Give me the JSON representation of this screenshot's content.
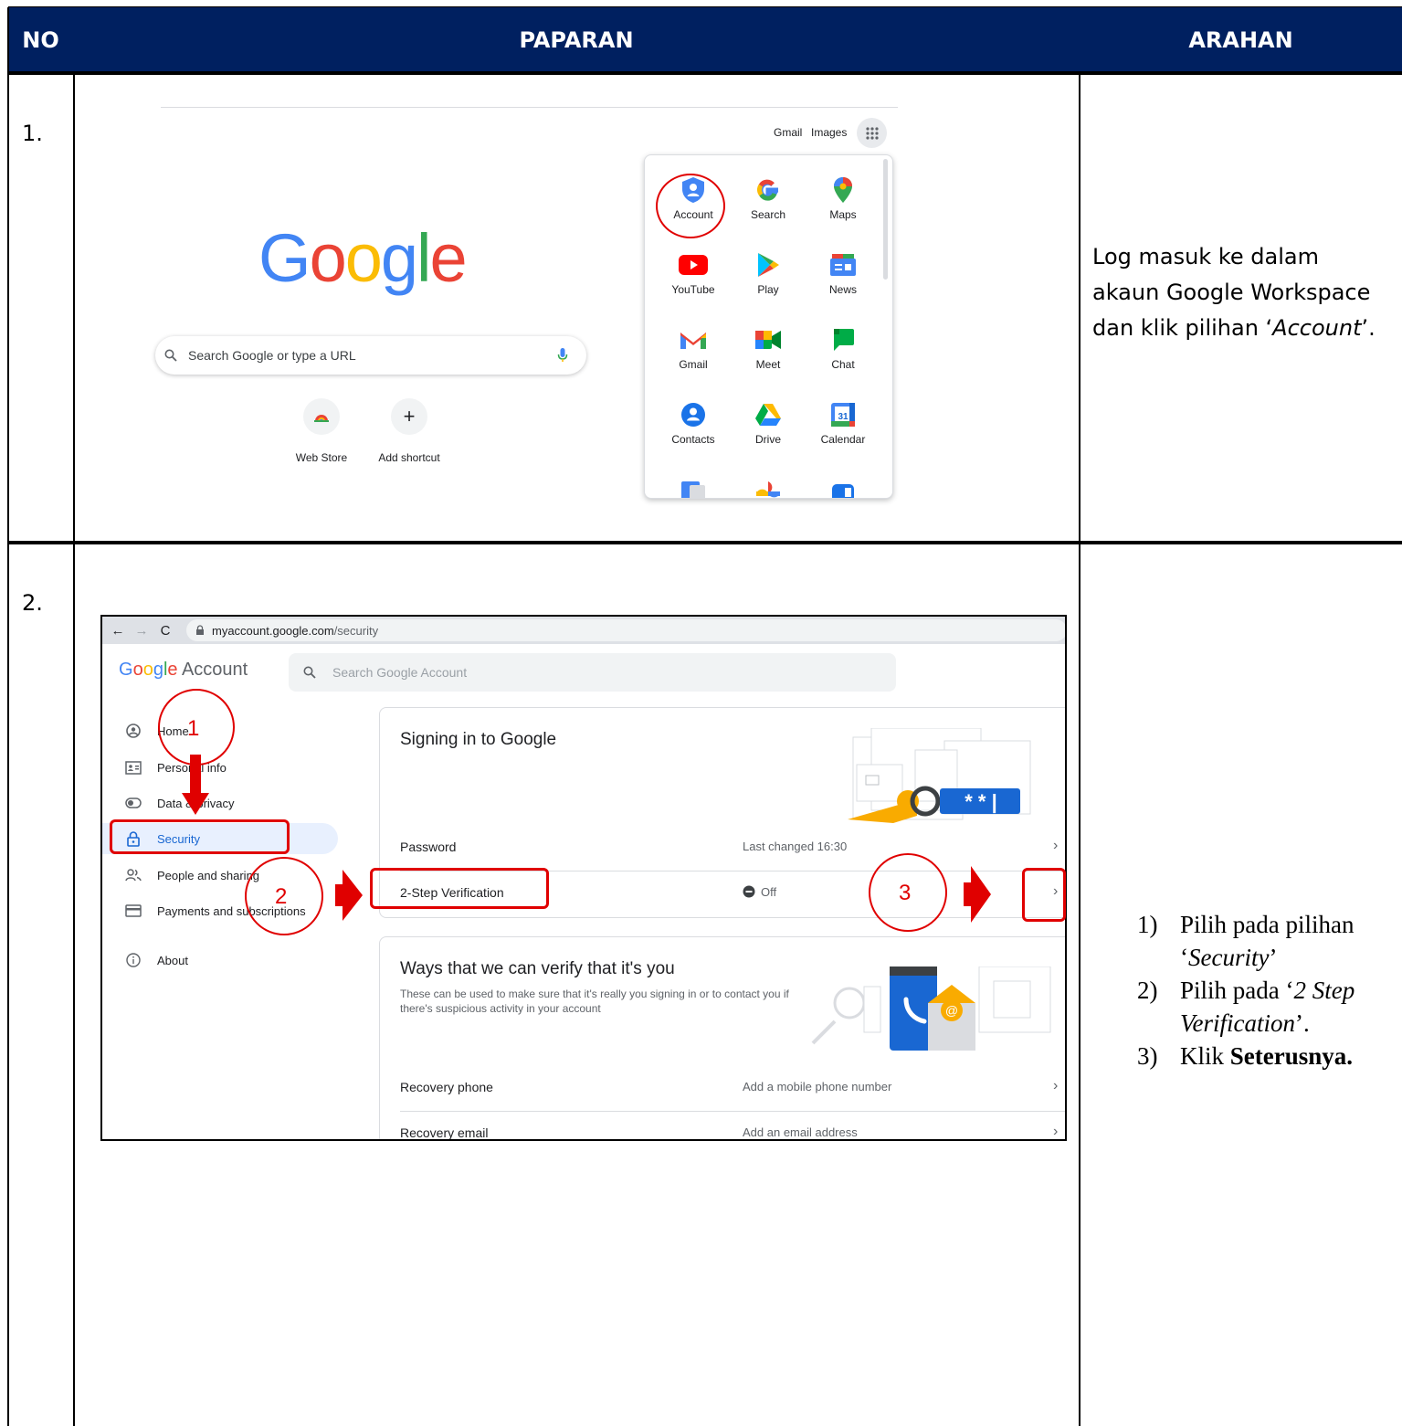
{
  "table": {
    "headers": [
      "NO",
      "PAPARAN",
      "ARAHAN"
    ],
    "rows": [
      {
        "no": "1.",
        "instruction_parts": [
          "Log masuk ke dalam akaun Google Workspace dan klik pilihan ‘",
          "Account",
          "’."
        ]
      },
      {
        "no": "2.",
        "steps": [
          {
            "num": "1)",
            "parts": [
              "Pilih pada pilihan ‘",
              "Security",
              "’"
            ]
          },
          {
            "num": "2)",
            "parts": [
              " Pilih pada ‘",
              "2 Step Verification",
              "’."
            ]
          },
          {
            "num": "3)",
            "parts": [
              "Klik ",
              "Seterusnya."
            ]
          }
        ]
      }
    ]
  },
  "screen1": {
    "top_links": [
      "Gmail",
      "Images"
    ],
    "logo_letters": [
      {
        "ch": "G",
        "color": "#4285F4"
      },
      {
        "ch": "o",
        "color": "#EA4335"
      },
      {
        "ch": "o",
        "color": "#FBBC05"
      },
      {
        "ch": "g",
        "color": "#4285F4"
      },
      {
        "ch": "l",
        "color": "#34A853"
      },
      {
        "ch": "e",
        "color": "#EA4335"
      }
    ],
    "search_placeholder": "Search Google or type a URL",
    "shortcuts": [
      {
        "label": "Web Store",
        "icon": "chrome-web-store-icon"
      },
      {
        "label": "Add shortcut",
        "icon": "plus-icon"
      }
    ],
    "apps": [
      {
        "label": "Account",
        "icon": "account-shield-icon"
      },
      {
        "label": "Search",
        "icon": "google-g-icon"
      },
      {
        "label": "Maps",
        "icon": "maps-pin-icon"
      },
      {
        "label": "YouTube",
        "icon": "youtube-icon"
      },
      {
        "label": "Play",
        "icon": "play-icon"
      },
      {
        "label": "News",
        "icon": "news-icon"
      },
      {
        "label": "Gmail",
        "icon": "gmail-icon"
      },
      {
        "label": "Meet",
        "icon": "meet-icon"
      },
      {
        "label": "Chat",
        "icon": "chat-icon"
      },
      {
        "label": "Contacts",
        "icon": "contacts-icon"
      },
      {
        "label": "Drive",
        "icon": "drive-icon"
      },
      {
        "label": "Calendar",
        "icon": "calendar-icon"
      }
    ],
    "calendar_day": "31"
  },
  "screen2": {
    "url_host": "myaccount.google.com",
    "url_path": "/security",
    "logo_letters": [
      {
        "ch": "G",
        "color": "#4285F4"
      },
      {
        "ch": "o",
        "color": "#EA4335"
      },
      {
        "ch": "o",
        "color": "#FBBC05"
      },
      {
        "ch": "g",
        "color": "#4285F4"
      },
      {
        "ch": "l",
        "color": "#34A853"
      },
      {
        "ch": "e",
        "color": "#EA4335"
      }
    ],
    "logo_suffix": "Account",
    "search_placeholder": "Search Google Account",
    "nav": [
      {
        "label": "Home",
        "icon": "home-icon"
      },
      {
        "label": "Personal info",
        "icon": "personal-info-icon"
      },
      {
        "label": "Data & privacy",
        "icon": "toggle-icon"
      },
      {
        "label": "Security",
        "icon": "lock-icon"
      },
      {
        "label": "People and sharing",
        "icon": "people-icon"
      },
      {
        "label": "Payments and subscriptions",
        "icon": "card-icon"
      },
      {
        "label": "About",
        "icon": "info-icon"
      }
    ],
    "signin": {
      "title": "Signing in to Google",
      "rows": [
        {
          "label": "Password",
          "value": "Last changed 16:30"
        },
        {
          "label": "2-Step Verification",
          "value": "Off"
        }
      ]
    },
    "verify": {
      "title": "Ways that we can verify that it's you",
      "desc": "These can be used to make sure that it's really you signing in or to contact you if there's suspicious activity in your account",
      "rows": [
        {
          "label": "Recovery phone",
          "value": "Add a mobile phone number"
        },
        {
          "label": "Recovery email",
          "value": "Add an email address"
        }
      ]
    },
    "annotations": [
      "1",
      "2",
      "3"
    ]
  },
  "colors": {
    "header_bg": "#002060",
    "annotation_red": "#E00000",
    "active_nav": "#E8F0FE"
  }
}
